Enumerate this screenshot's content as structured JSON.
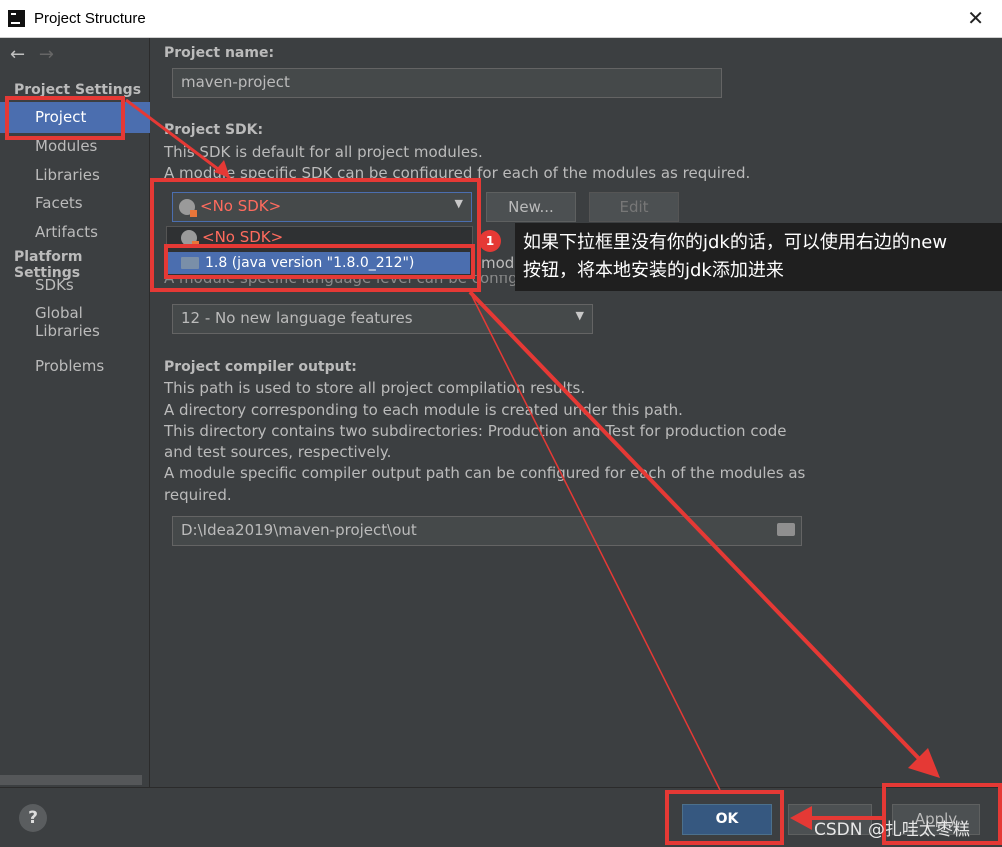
{
  "window": {
    "title": "Project Structure",
    "close": "✕"
  },
  "sidebar": {
    "back": "←",
    "forward": "→",
    "project_settings": "Project Settings",
    "items_top": [
      "Project",
      "Modules",
      "Libraries",
      "Facets",
      "Artifacts"
    ],
    "platform_settings": "Platform Settings",
    "items_platform": [
      "SDKs",
      "Global Libraries"
    ],
    "problems": "Problems"
  },
  "main": {
    "project_name_label": "Project name:",
    "project_name_value": "maven-project",
    "sdk_label": "Project SDK:",
    "sdk_desc1": "This SDK is default for all project modules.",
    "sdk_desc2": "A module specific SDK can be configured for each of the modules as required.",
    "sdk_selected": "<No SDK>",
    "new_btn": "New...",
    "edit_btn": "Edit",
    "dropdown_options": [
      "<No SDK>",
      "1.8 (java version \"1.8.0_212\")"
    ],
    "lang_desc_partial_1": "modul",
    "lang_desc_partial_2": "A module specific language level can be configured for each of the modules as required.",
    "lang_value": "12 - No new language features",
    "compiler_label": "Project compiler output:",
    "compiler_desc": [
      "This path is used to store all project compilation results.",
      "A directory corresponding to each module is created under this path.",
      "This directory contains two subdirectories: Production and Test for production code",
      "and test sources, respectively.",
      "A module specific compiler output path can be configured for each of the modules as",
      "required."
    ],
    "compiler_path": "D:\\Idea2019\\maven-project\\out"
  },
  "footer": {
    "help": "?",
    "ok": "OK",
    "apply": "Apply"
  },
  "annotation": {
    "badge": "1",
    "line1": "如果下拉框里没有你的jdk的话，可以使用右边的new",
    "line2": "按钮，将本地安装的jdk添加进来"
  },
  "watermark": "CSDN @扎哇太枣糕",
  "colors": {
    "accent": "#4b6eaf",
    "annotation_red": "#e53935",
    "no_sdk_red": "#ff6b5e",
    "ok_blue": "#365880"
  }
}
